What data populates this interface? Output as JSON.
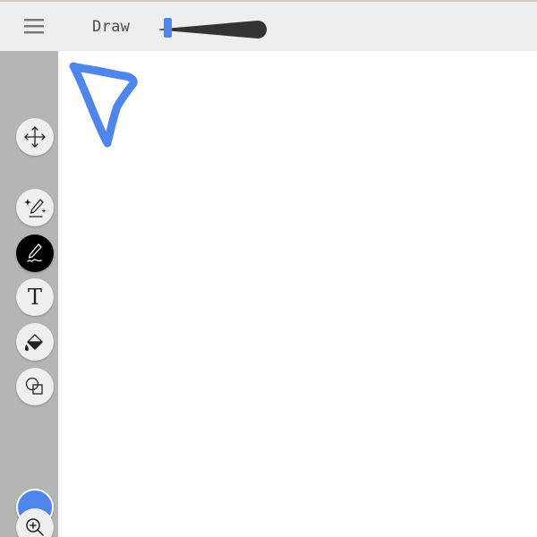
{
  "app": {
    "title": "Draw",
    "icons": {
      "menu": "hamburger-menu-icon",
      "brush_size": "brush-size-slider-icon"
    }
  },
  "toolbar": {
    "tools": [
      {
        "name": "move",
        "icon": "move-arrows-icon",
        "active": false
      },
      {
        "name": "magic-pen",
        "icon": "magic-pen-icon",
        "active": false
      },
      {
        "name": "pen",
        "icon": "pen-icon",
        "active": true
      },
      {
        "name": "text",
        "icon": "text-icon",
        "glyph": "T",
        "active": false
      },
      {
        "name": "fill",
        "icon": "paint-bucket-icon",
        "active": false
      },
      {
        "name": "shapes",
        "icon": "shapes-icon",
        "active": false
      },
      {
        "name": "zoom",
        "icon": "zoom-in-icon",
        "active": false
      }
    ],
    "selected_color": "#4f86ec"
  },
  "colors": {
    "header_bg": "#eeeeee",
    "sidebar_bg": "#b5b5b5",
    "accent": "#4f86ec",
    "active_tool_bg": "#000000"
  }
}
